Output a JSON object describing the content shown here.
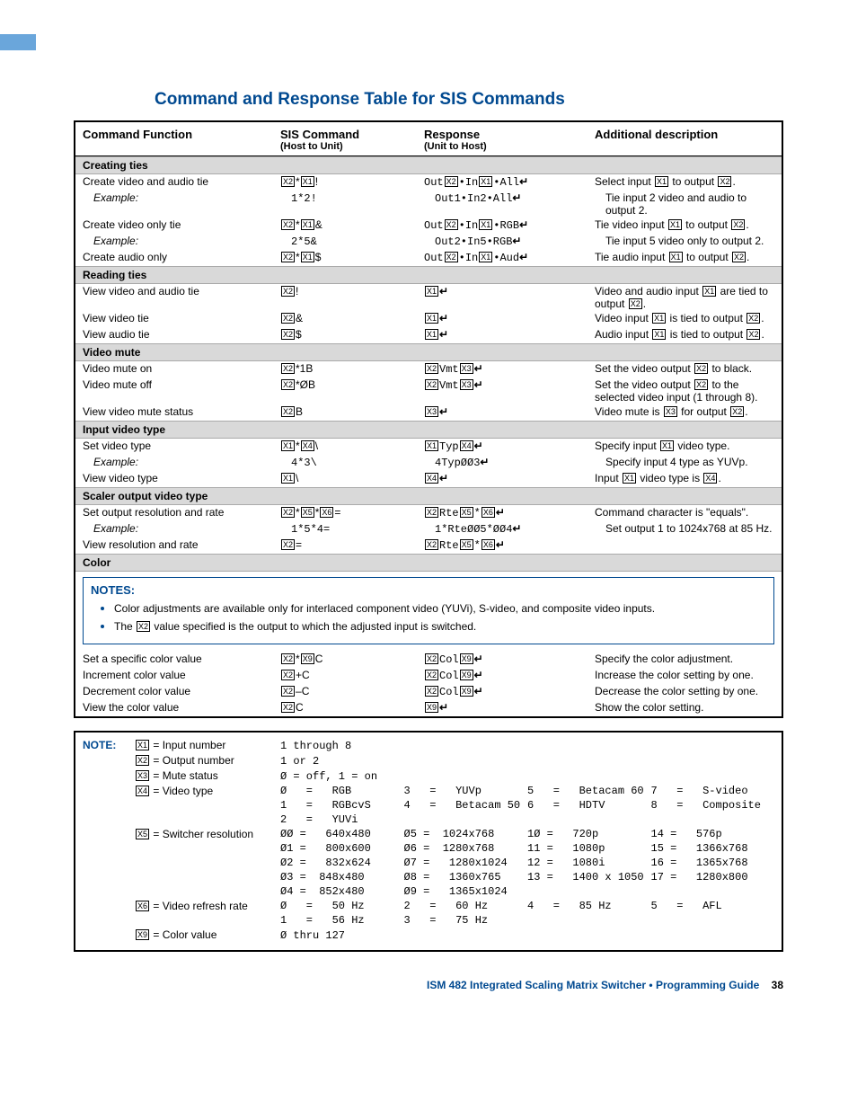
{
  "title": "Command and Response Table for SIS Commands",
  "headers": {
    "func": "Command Function",
    "cmd": "SIS Command",
    "cmd_sub": "(Host to Unit)",
    "resp": "Response",
    "resp_sub": "(Unit to Host)",
    "desc": "Additional description"
  },
  "sections": [
    {
      "name": "Creating ties",
      "rows": [
        {
          "func": "Create video and audio tie",
          "cmd": [
            "X2",
            "*",
            "X1",
            "!"
          ],
          "resp": [
            "Out",
            "X2",
            "•In",
            "X1",
            "•All",
            "↵"
          ],
          "desc": [
            "Select input ",
            "X1",
            " to output ",
            "X2",
            "."
          ]
        },
        {
          "func": "Example:",
          "indent": true,
          "cmd_text": "1*2!",
          "resp": [
            "Out1•In2•All",
            "↵"
          ],
          "desc_text": "Tie input 2 video and audio to output 2."
        },
        {
          "func": "Create video only tie",
          "cmd": [
            "X2",
            "*",
            "X1",
            "&"
          ],
          "resp": [
            "Out",
            "X2",
            "•In",
            "X1",
            "•RGB",
            "↵"
          ],
          "desc": [
            "Tie video input ",
            "X1",
            " to output ",
            "X2",
            "."
          ]
        },
        {
          "func": "Example:",
          "indent": true,
          "cmd_text": "2*5&",
          "resp": [
            "Out2•In5•RGB",
            "↵"
          ],
          "desc_text": "Tie input 5 video only to output 2."
        },
        {
          "func": "Create audio only",
          "cmd": [
            "X2",
            "*",
            "X1",
            "$"
          ],
          "resp": [
            "Out",
            "X2",
            "•In",
            "X1",
            "•Aud",
            "↵"
          ],
          "desc": [
            "Tie audio input ",
            "X1",
            " to output ",
            "X2",
            "."
          ]
        }
      ]
    },
    {
      "name": "Reading ties",
      "rows": [
        {
          "func": "View video and audio tie",
          "cmd": [
            "X2",
            "!"
          ],
          "resp": [
            "X1",
            "↵"
          ],
          "desc": [
            "Video and audio input ",
            "X1",
            " are tied to output ",
            "X2",
            "."
          ]
        },
        {
          "func": "View video tie",
          "cmd": [
            "X2",
            "&"
          ],
          "resp": [
            "X1",
            "↵"
          ],
          "desc": [
            "Video input ",
            "X1",
            " is tied to output ",
            "X2",
            "."
          ]
        },
        {
          "func": "View audio tie",
          "cmd": [
            "X2",
            "$"
          ],
          "resp": [
            "X1",
            "↵"
          ],
          "desc": [
            "Audio input ",
            "X1",
            " is tied to output ",
            "X2",
            "."
          ]
        }
      ]
    },
    {
      "name": "Video mute",
      "rows": [
        {
          "func": "Video mute on",
          "cmd": [
            "X2",
            "*1B"
          ],
          "resp": [
            "X2",
            "Vmt",
            "X3",
            "↵"
          ],
          "desc": [
            "Set the video output ",
            "X2",
            " to black."
          ]
        },
        {
          "func": "Video mute off",
          "cmd": [
            "X2",
            "*ØB"
          ],
          "resp": [
            "X2",
            "Vmt",
            "X3",
            "↵"
          ],
          "desc": [
            "Set the video output ",
            "X2",
            " to the selected video input (1 through 8)."
          ]
        },
        {
          "func": "View video mute status",
          "cmd": [
            "X2",
            "B"
          ],
          "resp": [
            "X3",
            "↵"
          ],
          "desc": [
            "Video mute is ",
            "X3",
            " for output ",
            "X2",
            "."
          ]
        }
      ]
    },
    {
      "name": "Input video type",
      "rows": [
        {
          "func": "Set video type",
          "cmd": [
            "X1",
            "*",
            "X4",
            "\\"
          ],
          "resp": [
            "X1",
            "Typ",
            "X4",
            "↵"
          ],
          "desc": [
            "Specify input ",
            "X1",
            " video type."
          ]
        },
        {
          "func": "Example:",
          "indent": true,
          "cmd_text": "4*3\\",
          "resp": [
            "4TypØØ3",
            "↵"
          ],
          "desc_text": "Specify input 4 type as YUVp."
        },
        {
          "func": "View video type",
          "cmd": [
            "X1",
            "\\"
          ],
          "resp": [
            "X4",
            "↵"
          ],
          "desc": [
            "Input ",
            "X1",
            " video type is ",
            "X4",
            "."
          ]
        }
      ]
    },
    {
      "name": "Scaler output video type",
      "rows": [
        {
          "func": "Set output resolution and rate",
          "cmd": [
            "X2",
            "*",
            "X5",
            "*",
            "X6",
            "="
          ],
          "resp": [
            "X2",
            "Rte",
            "X5",
            "*",
            "X6",
            "↵"
          ],
          "desc_text": "Command character is \"equals\"."
        },
        {
          "func": "Example:",
          "indent": true,
          "cmd_text": "1*5*4=",
          "resp": [
            "1*RteØØ5*ØØ4",
            "↵"
          ],
          "desc_text": "Set output 1 to 1024x768 at 85 Hz."
        },
        {
          "func": "View resolution and rate",
          "cmd": [
            "X2",
            "="
          ],
          "resp": [
            "X2",
            "Rte",
            "X5",
            "*",
            "X6",
            "↵"
          ],
          "desc_text": ""
        }
      ]
    },
    {
      "name": "Color",
      "notes": {
        "title": "NOTES:",
        "items": [
          "Color adjustments are available only for interlaced component video (YUVi), S-video, and composite video inputs.",
          [
            "The ",
            "X2",
            " value specified is the output to which the adjusted input is switched."
          ]
        ]
      },
      "rows": [
        {
          "func": "Set a specific color value",
          "cmd": [
            "X2",
            "*",
            "X9",
            "C"
          ],
          "resp": [
            "X2",
            "Col",
            "X9",
            "↵"
          ],
          "desc_text": "Specify the color adjustment."
        },
        {
          "func": "Increment color value",
          "cmd": [
            "X2",
            "+C"
          ],
          "resp": [
            "X2",
            "Col",
            "X9",
            "↵"
          ],
          "desc_text": "Increase the color setting by one."
        },
        {
          "func": "Decrement color value",
          "cmd": [
            "X2",
            "–C"
          ],
          "resp": [
            "X2",
            "Col",
            "X9",
            "↵"
          ],
          "desc_text": "Decrease the color setting by one."
        },
        {
          "func": "View the color value",
          "cmd": [
            "X2",
            "C"
          ],
          "resp": [
            "X9",
            "↵"
          ],
          "desc_text": "Show the color setting."
        }
      ]
    }
  ],
  "legend": {
    "label": "NOTE:",
    "defs": [
      {
        "var": "X1",
        "name": "Input number",
        "value": "1 through 8"
      },
      {
        "var": "X2",
        "name": "Output number",
        "value": "1 or 2"
      },
      {
        "var": "X3",
        "name": "Mute status",
        "value": "Ø = off, 1 = on"
      },
      {
        "var": "X4",
        "name": "Video type",
        "cols": [
          "Ø   =   RGB\n1   =   RGBcvS\n2   =   YUVi",
          "3   =   YUVp\n4   =   Betacam 50",
          "5   =   Betacam 60\n6   =   HDTV",
          "7   =   S-video\n8   =   Composite"
        ]
      },
      {
        "var": "X5",
        "name": "Switcher resolution",
        "cols": [
          "ØØ =   640x480\nØ1 =   800x600\nØ2 =   832x624\nØ3 =  848x480\nØ4 =  852x480",
          "Ø5 =  1024x768\nØ6 =  1280x768\nØ7 =   1280x1024\nØ8 =   1360x765\nØ9 =   1365x1024",
          "1Ø =   720p\n11 =   1080p\n12 =   1080i\n13 =   1400 x 1050",
          "14 =   576p\n15 =   1366x768\n16 =   1365x768\n17 =   1280x800"
        ]
      },
      {
        "var": "X6",
        "name": "Video refresh rate",
        "cols": [
          "Ø   =   50 Hz\n1   =   56 Hz",
          "2   =   60 Hz\n3   =   75 Hz",
          "4   =   85 Hz",
          "5   =   AFL"
        ]
      },
      {
        "var": "X9",
        "name": "Color value",
        "value": "Ø thru 127"
      }
    ]
  },
  "footer": {
    "text": "ISM 482 Integrated Scaling Matrix Switcher • Programming Guide",
    "page": "38"
  }
}
